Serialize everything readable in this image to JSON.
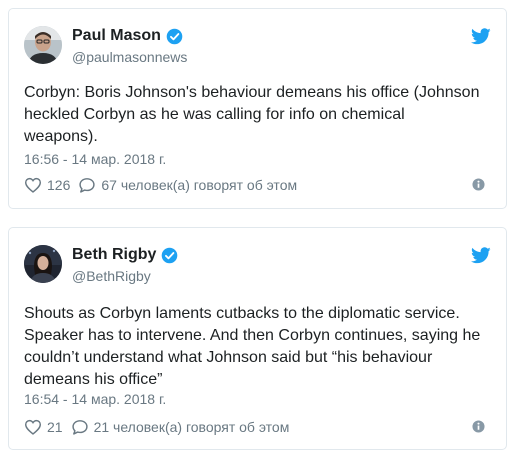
{
  "tweets": [
    {
      "author": {
        "name": "Paul Mason",
        "handle": "@paulmasonnews",
        "verified": true
      },
      "text": "Corbyn: Boris Johnson's behaviour demeans his office (Johnson\nheckled Corbyn as he was calling for info on chemical\nweapons).",
      "timestamp": "16:56 - 14 мар. 2018 г.",
      "likes": "126",
      "replies": "67 человек(а) говорят об этом"
    },
    {
      "author": {
        "name": "Beth Rigby",
        "handle": "@BethRigby",
        "verified": true
      },
      "text": "Shouts as Corbyn laments cutbacks to the diplomatic service.\nSpeaker has to intervene. And then Corbyn continues, saying he\ncouldn’t understand what Johnson said but “his behaviour\ndemeans his office”",
      "timestamp": "16:54 - 14 мар. 2018 г.",
      "likes": "21",
      "replies": "21 человек(а) говорят об этом"
    }
  ],
  "colors": {
    "twitter_blue": "#1da1f2",
    "secondary_text": "#697882",
    "primary_text": "#1c2022",
    "border": "#e1e8ed"
  },
  "icons": [
    "verified-badge-icon",
    "twitter-bird-icon",
    "heart-icon",
    "reply-bubble-icon",
    "info-icon"
  ]
}
